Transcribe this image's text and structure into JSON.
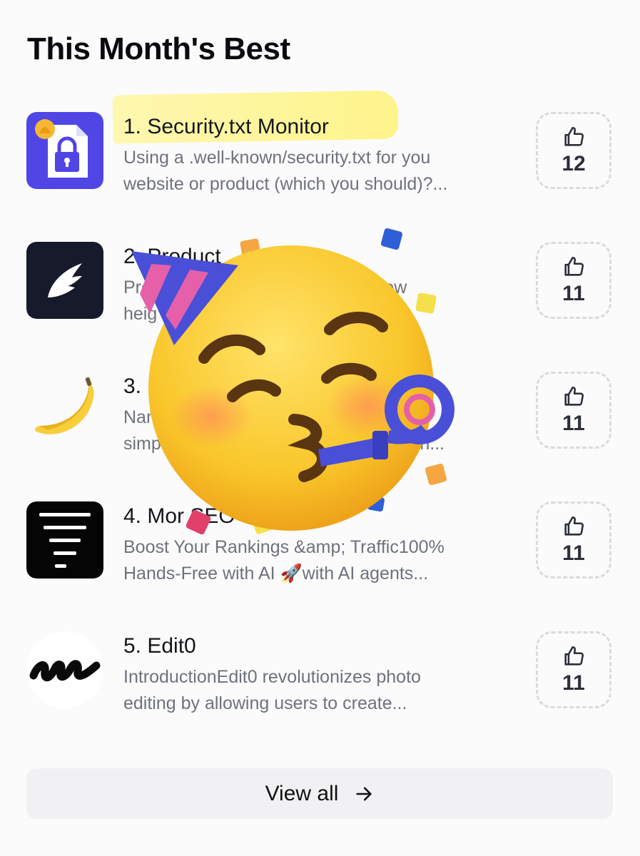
{
  "section": {
    "title": "This Month's Best"
  },
  "items": [
    {
      "rank_name": "1. Security.txt Monitor",
      "desc_line1": "Using a .well-known/security.txt for you",
      "desc_line2": "website or product (which you should)?...",
      "votes": "12"
    },
    {
      "rank_name": "2. Product",
      "desc_line1": "Pro                                             new",
      "desc_line2": "heig                                              e...",
      "votes": "11"
    },
    {
      "rank_name": "3. N",
      "desc_line1": "Nanc                                              ing",
      "desc_line2": "simple                                         l editin...",
      "votes": "11"
    },
    {
      "rank_name": "4. Mor SEO",
      "desc_line1": "Boost Your Rankings &amp; Traffic100%",
      "desc_line2": "Hands-Free with AI 🚀with AI agents...",
      "votes": "11"
    },
    {
      "rank_name": "5. Edit0",
      "desc_line1": "IntroductionEdit0 revolutionizes photo",
      "desc_line2": "editing by allowing users to create...",
      "votes": "11"
    }
  ],
  "footer": {
    "view_all_label": "View all"
  },
  "icons": {
    "vote": "thumbs-up-icon",
    "view_all": "arrow-right-icon",
    "overlay": "partying-face-emoji"
  },
  "colors": {
    "accent_blue": "#4f46e5",
    "highlight": "#fff38a",
    "vote_border": "#d9dbdf"
  }
}
